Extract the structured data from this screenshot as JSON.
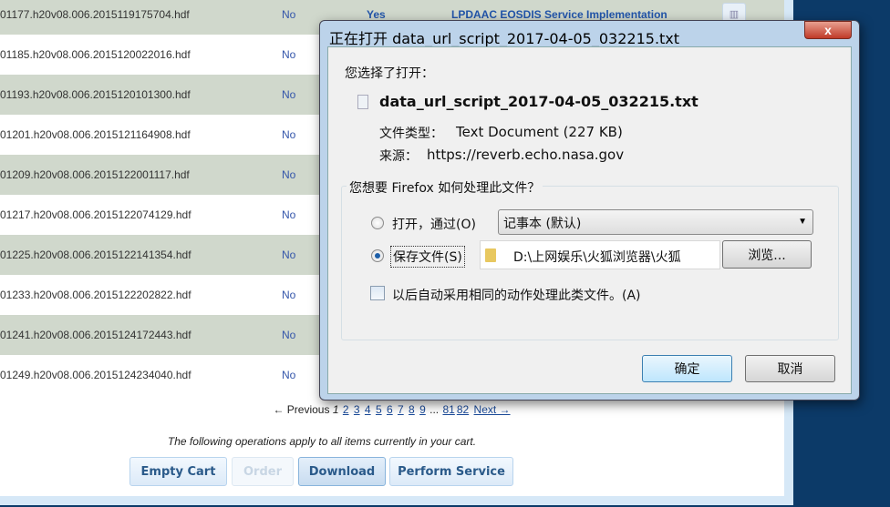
{
  "rows": [
    {
      "file": "01177.h20v08.006.2015119175704.hdf",
      "online": "No",
      "extra": "Yes",
      "service": "LPDAAC EOSDIS Service Implementation"
    },
    {
      "file": "01185.h20v08.006.2015120022016.hdf",
      "online": "No"
    },
    {
      "file": "01193.h20v08.006.2015120101300.hdf",
      "online": "No"
    },
    {
      "file": "01201.h20v08.006.2015121164908.hdf",
      "online": "No"
    },
    {
      "file": "01209.h20v08.006.2015122001117.hdf",
      "online": "No"
    },
    {
      "file": "01217.h20v08.006.2015122074129.hdf",
      "online": "No"
    },
    {
      "file": "01225.h20v08.006.2015122141354.hdf",
      "online": "No"
    },
    {
      "file": "01233.h20v08.006.2015122202822.hdf",
      "online": "No"
    },
    {
      "file": "01241.h20v08.006.2015124172443.hdf",
      "online": "No"
    },
    {
      "file": "01249.h20v08.006.2015124234040.hdf",
      "online": "No"
    }
  ],
  "pager": {
    "prev": "← Previous",
    "current": "1",
    "pages": [
      "2",
      "3",
      "4",
      "5",
      "6",
      "7",
      "8",
      "9"
    ],
    "ellipsis": "...",
    "last": [
      "81",
      "82"
    ],
    "next": "Next →"
  },
  "note": "The following operations apply to all items currently in your cart.",
  "buttons": {
    "empty": "Empty Cart",
    "order": "Order",
    "download": "Download",
    "perform": "Perform Service"
  },
  "dialog": {
    "title": "正在打开 data_url_script_2017-04-05_032215.txt",
    "close": "x",
    "chosen": "您选择了打开：",
    "filename": "data_url_script_2017-04-05_032215.txt",
    "type_label": "文件类型：",
    "type_value": "Text Document (227 KB)",
    "source_label": "来源：",
    "source_value": "https://reverb.echo.nasa.gov",
    "question": "您想要 Firefox 如何处理此文件？",
    "open_with": "打开，通过(O)",
    "open_app": "记事本 (默认)",
    "save_file": "保存文件(S)",
    "save_path": "D:\\上网娱乐\\火狐浏览器\\火狐",
    "browse": "浏览...",
    "auto": "以后自动采用相同的动作处理此类文件。(A)",
    "ok": "确定",
    "cancel": "取消",
    "selected_option": "save"
  }
}
